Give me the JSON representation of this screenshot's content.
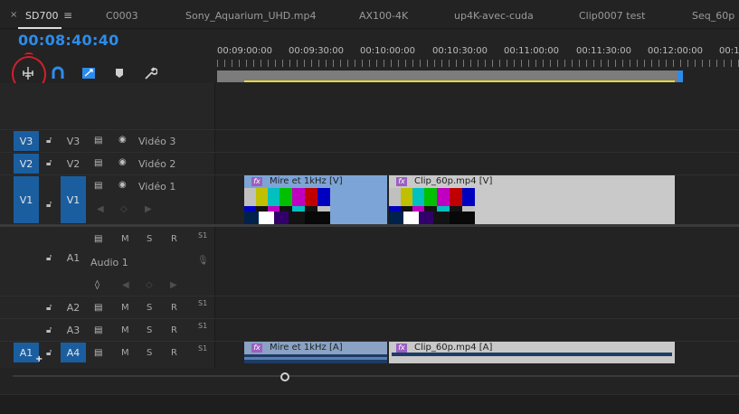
{
  "tabs": {
    "close_glyph": "×",
    "menu_glyph": "≡",
    "items": [
      {
        "label": "SD700"
      },
      {
        "label": "C0003"
      },
      {
        "label": "Sony_Aquarium_UHD.mp4"
      },
      {
        "label": "AX100-4K"
      },
      {
        "label": "up4K-avec-cuda"
      },
      {
        "label": "Clip0007 test"
      },
      {
        "label": "Seq_60p"
      }
    ]
  },
  "timecode": "00:08:40:40",
  "tools": [
    "insert-edit-icon",
    "snap-magnet-icon",
    "linked-selection-icon",
    "add-marker-icon",
    "wrench-settings-icon"
  ],
  "ruler": {
    "labels": [
      "00:09:00:00",
      "00:09:30:00",
      "00:10:00:00",
      "00:10:30:00",
      "00:11:00:00",
      "00:11:30:00",
      "00:12:00:00",
      "00:1"
    ]
  },
  "tracks": {
    "video": [
      {
        "source": "V3",
        "target": "V3",
        "name": "Vidéo 3"
      },
      {
        "source": "V2",
        "target": "V2",
        "name": "Vidéo 2"
      },
      {
        "source": "V1",
        "target": "V1",
        "name": "Vidéo 1"
      }
    ],
    "audio": [
      {
        "source": "",
        "target": "A1",
        "name": "Audio 1",
        "m": "M",
        "s": "S",
        "r": "R",
        "db": "S1"
      },
      {
        "source": "",
        "target": "A2",
        "m": "M",
        "s": "S",
        "r": "R",
        "db": "S1"
      },
      {
        "source": "",
        "target": "A3",
        "m": "M",
        "s": "S",
        "r": "R",
        "db": "S1"
      },
      {
        "source": "A1",
        "target": "A4",
        "m": "M",
        "s": "S",
        "r": "R",
        "db": "S1"
      }
    ]
  },
  "clips": {
    "video": [
      {
        "label": "Mire et 1kHz [V]",
        "fx": "fx"
      },
      {
        "label": "Clip_60p.mp4 [V]",
        "fx": "fx"
      }
    ],
    "audio": [
      {
        "label": "Mire et 1kHz [A]",
        "fx": "fx"
      },
      {
        "label": "Clip_60p.mp4 [A]",
        "fx": "fx"
      }
    ]
  },
  "colors": {
    "accent": "#2d8ceb",
    "patch": "#1b5ea0",
    "mire_clip": "#7da4d6",
    "clip60p": "#c9c9c9",
    "annotation": "#d0202a",
    "workarea_marker": "#e3d83a"
  }
}
